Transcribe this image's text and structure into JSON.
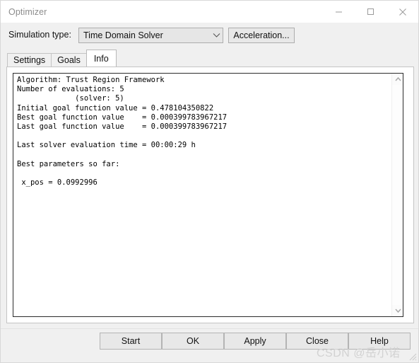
{
  "window": {
    "title": "Optimizer",
    "controls": {
      "minimize": "Minimize",
      "maximize": "Maximize",
      "close": "Close"
    }
  },
  "toolbar": {
    "simulation_type_label": "Simulation type:",
    "simulation_type_value": "Time Domain Solver",
    "acceleration_button": "Acceleration..."
  },
  "tabs": [
    {
      "label": "Settings",
      "active": false
    },
    {
      "label": "Goals",
      "active": false
    },
    {
      "label": "Info",
      "active": true
    }
  ],
  "info_output": {
    "text": "Algorithm: Trust Region Framework\nNumber of evaluations: 5\n             (solver: 5)\nInitial goal function value = 0.478104350822\nBest goal function value    = 0.000399783967217\nLast goal function value    = 0.000399783967217\n\nLast solver evaluation time = 00:00:29 h\n\nBest parameters so far:\n\n x_pos = 0.0992996",
    "lines": [
      "Algorithm: Trust Region Framework",
      "Number of evaluations: 5",
      "             (solver: 5)",
      "Initial goal function value = 0.478104350822",
      "Best goal function value    = 0.000399783967217",
      "Last goal function value    = 0.000399783967217",
      "",
      "Last solver evaluation time = 00:00:29 h",
      "",
      "Best parameters so far:",
      "",
      " x_pos = 0.0992996"
    ],
    "values": {
      "algorithm": "Trust Region Framework",
      "number_of_evaluations": 5,
      "solver_evaluations": 5,
      "initial_goal_function_value": "0.478104350822",
      "best_goal_function_value": "0.000399783967217",
      "last_goal_function_value": "0.000399783967217",
      "last_solver_evaluation_time": "00:00:29 h",
      "best_parameter_name": "x_pos",
      "best_parameter_value": "0.0992996"
    }
  },
  "buttons": {
    "start": "Start",
    "ok": "OK",
    "apply": "Apply",
    "close": "Close",
    "help": "Help"
  },
  "watermark": {
    "text": "CSDN @岳小诺"
  }
}
